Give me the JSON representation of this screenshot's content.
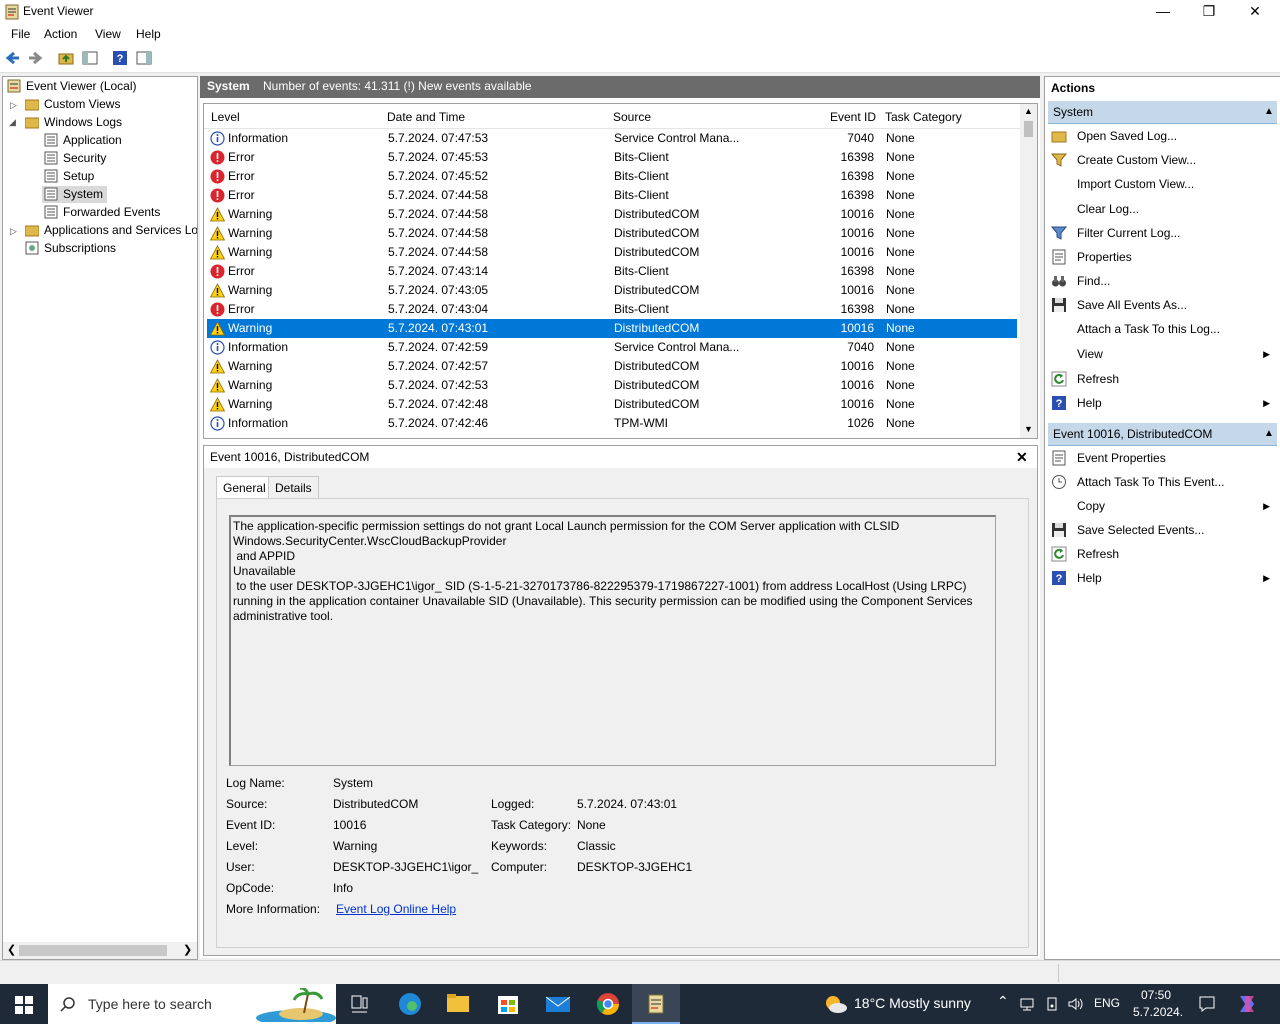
{
  "window": {
    "title": "Event Viewer"
  },
  "menu": [
    "File",
    "Action",
    "View",
    "Help"
  ],
  "tree": {
    "root": "Event Viewer (Local)",
    "custom_views": "Custom Views",
    "windows_logs": "Windows Logs",
    "application": "Application",
    "security": "Security",
    "setup": "Setup",
    "system": "System",
    "forwarded": "Forwarded Events",
    "apps_services": "Applications and Services Lo",
    "subscriptions": "Subscriptions"
  },
  "log_header": {
    "name": "System",
    "info": "Number of events: 41.311 (!) New events available"
  },
  "columns": {
    "level": "Level",
    "datetime": "Date and Time",
    "source": "Source",
    "event_id": "Event ID",
    "task_category": "Task Category"
  },
  "events": [
    {
      "level": "Information",
      "datetime": "5.7.2024. 07:47:53",
      "source": "Service Control Mana...",
      "event_id": "7040",
      "task": "None",
      "icon": "info-icon"
    },
    {
      "level": "Error",
      "datetime": "5.7.2024. 07:45:53",
      "source": "Bits-Client",
      "event_id": "16398",
      "task": "None",
      "icon": "error-icon"
    },
    {
      "level": "Error",
      "datetime": "5.7.2024. 07:45:52",
      "source": "Bits-Client",
      "event_id": "16398",
      "task": "None",
      "icon": "error-icon"
    },
    {
      "level": "Error",
      "datetime": "5.7.2024. 07:44:58",
      "source": "Bits-Client",
      "event_id": "16398",
      "task": "None",
      "icon": "error-icon"
    },
    {
      "level": "Warning",
      "datetime": "5.7.2024. 07:44:58",
      "source": "DistributedCOM",
      "event_id": "10016",
      "task": "None",
      "icon": "warning-icon"
    },
    {
      "level": "Warning",
      "datetime": "5.7.2024. 07:44:58",
      "source": "DistributedCOM",
      "event_id": "10016",
      "task": "None",
      "icon": "warning-icon"
    },
    {
      "level": "Warning",
      "datetime": "5.7.2024. 07:44:58",
      "source": "DistributedCOM",
      "event_id": "10016",
      "task": "None",
      "icon": "warning-icon"
    },
    {
      "level": "Error",
      "datetime": "5.7.2024. 07:43:14",
      "source": "Bits-Client",
      "event_id": "16398",
      "task": "None",
      "icon": "error-icon"
    },
    {
      "level": "Warning",
      "datetime": "5.7.2024. 07:43:05",
      "source": "DistributedCOM",
      "event_id": "10016",
      "task": "None",
      "icon": "warning-icon"
    },
    {
      "level": "Error",
      "datetime": "5.7.2024. 07:43:04",
      "source": "Bits-Client",
      "event_id": "16398",
      "task": "None",
      "icon": "error-icon"
    },
    {
      "level": "Warning",
      "datetime": "5.7.2024. 07:43:01",
      "source": "DistributedCOM",
      "event_id": "10016",
      "task": "None",
      "icon": "warning-icon",
      "selected": true
    },
    {
      "level": "Information",
      "datetime": "5.7.2024. 07:42:59",
      "source": "Service Control Mana...",
      "event_id": "7040",
      "task": "None",
      "icon": "info-icon"
    },
    {
      "level": "Warning",
      "datetime": "5.7.2024. 07:42:57",
      "source": "DistributedCOM",
      "event_id": "10016",
      "task": "None",
      "icon": "warning-icon"
    },
    {
      "level": "Warning",
      "datetime": "5.7.2024. 07:42:53",
      "source": "DistributedCOM",
      "event_id": "10016",
      "task": "None",
      "icon": "warning-icon"
    },
    {
      "level": "Warning",
      "datetime": "5.7.2024. 07:42:48",
      "source": "DistributedCOM",
      "event_id": "10016",
      "task": "None",
      "icon": "warning-icon"
    },
    {
      "level": "Information",
      "datetime": "5.7.2024. 07:42:46",
      "source": "TPM-WMI",
      "event_id": "1026",
      "task": "None",
      "icon": "info-icon"
    }
  ],
  "detail": {
    "title": "Event 10016, DistributedCOM",
    "tab_general": "General",
    "tab_details": "Details",
    "description": "The application-specific permission settings do not grant Local Launch permission for the COM Server application with CLSID \nWindows.SecurityCenter.WscCloudBackupProvider\n and APPID \nUnavailable\n to the user DESKTOP-3JGEHC1\\igor_ SID (S-1-5-21-3270173786-822295379-1719867227-1001) from address LocalHost (Using LRPC) running in the application container Unavailable SID (Unavailable). This security permission can be modified using the Component Services administrative tool.",
    "labels": {
      "log_name": "Log Name:",
      "source": "Source:",
      "event_id": "Event ID:",
      "level": "Level:",
      "user": "User:",
      "opcode": "OpCode:",
      "more_info": "More Information:",
      "logged": "Logged:",
      "task_category": "Task Category:",
      "keywords": "Keywords:",
      "computer": "Computer:"
    },
    "values": {
      "log_name": "System",
      "source": "DistributedCOM",
      "event_id": "10016",
      "level": "Warning",
      "user": "DESKTOP-3JGEHC1\\igor_",
      "opcode": "Info",
      "more_info": "Event Log Online Help",
      "logged": "5.7.2024. 07:43:01",
      "task_category": "None",
      "keywords": "Classic",
      "computer": "DESKTOP-3JGEHC1"
    }
  },
  "actions": {
    "title": "Actions",
    "section1": "System",
    "items1": [
      {
        "label": "Open Saved Log...",
        "icon": "open-folder-icon"
      },
      {
        "label": "Create Custom View...",
        "icon": "funnel-icon"
      },
      {
        "label": "Import Custom View...",
        "icon": ""
      },
      {
        "label": "Clear Log...",
        "icon": ""
      },
      {
        "label": "Filter Current Log...",
        "icon": "filter-icon"
      },
      {
        "label": "Properties",
        "icon": "properties-icon"
      },
      {
        "label": "Find...",
        "icon": "binoculars-icon"
      },
      {
        "label": "Save All Events As...",
        "icon": "save-icon"
      },
      {
        "label": "Attach a Task To this Log...",
        "icon": ""
      },
      {
        "label": "View",
        "icon": "",
        "submenu": true
      },
      {
        "label": "Refresh",
        "icon": "refresh-icon"
      },
      {
        "label": "Help",
        "icon": "help-icon",
        "submenu": true
      }
    ],
    "section2": "Event 10016, DistributedCOM",
    "items2": [
      {
        "label": "Event Properties",
        "icon": "properties-icon"
      },
      {
        "label": "Attach Task To This Event...",
        "icon": "task-icon"
      },
      {
        "label": "Copy",
        "icon": "",
        "submenu": true
      },
      {
        "label": "Save Selected Events...",
        "icon": "save-icon"
      },
      {
        "label": "Refresh",
        "icon": "refresh-icon"
      },
      {
        "label": "Help",
        "icon": "help-icon",
        "submenu": true
      }
    ]
  },
  "taskbar": {
    "search_placeholder": "Type here to search",
    "weather": "18°C  Mostly sunny",
    "lang": "ENG",
    "time": "07:50",
    "date": "5.7.2024."
  },
  "colors": {
    "selection": "#0078d7",
    "log_header": "#6b6b6b",
    "action_header": "#c5d8ea",
    "taskbar": "#1f2a38"
  }
}
